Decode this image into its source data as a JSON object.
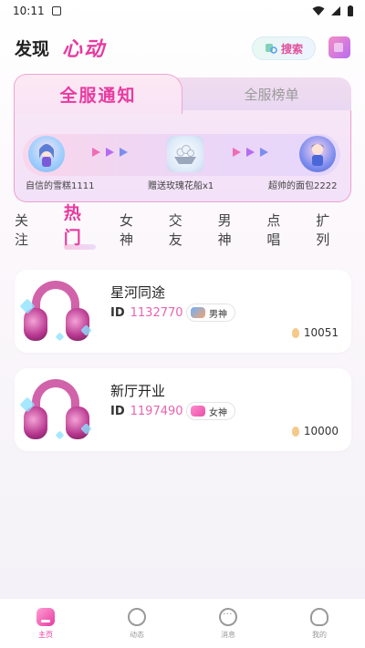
{
  "status": {
    "time": "10:11"
  },
  "header": {
    "tab_discover": "发现",
    "tab_heartbeat": "心动",
    "search_label": "搜索"
  },
  "notice": {
    "tab_active": "全服通知",
    "tab_inactive": "全服榜单",
    "sender": "自信的雪糕1111",
    "gift": "赠送玫瑰花船x1",
    "receiver": "超帅的面包2222"
  },
  "filters": [
    "关注",
    "热门",
    "女神",
    "交友",
    "男神",
    "点唱",
    "扩列"
  ],
  "filter_active_index": 1,
  "rooms": [
    {
      "title": "星河同途",
      "id_label": "ID",
      "id": "1132770",
      "tag": "男神",
      "tag_type": "male",
      "heat": "10051"
    },
    {
      "title": "新厅开业",
      "id_label": "ID",
      "id": "1197490",
      "tag": "女神",
      "tag_type": "female",
      "heat": "10000"
    }
  ],
  "tabbar": [
    {
      "label": "主页",
      "icon": "home-icon",
      "active": true
    },
    {
      "label": "动态",
      "icon": "moments-icon",
      "active": false
    },
    {
      "label": "消息",
      "icon": "message-icon",
      "active": false
    },
    {
      "label": "我的",
      "icon": "profile-icon",
      "active": false
    }
  ],
  "colors": {
    "accent": "#e83aa0",
    "id_pink": "#e864b0"
  }
}
